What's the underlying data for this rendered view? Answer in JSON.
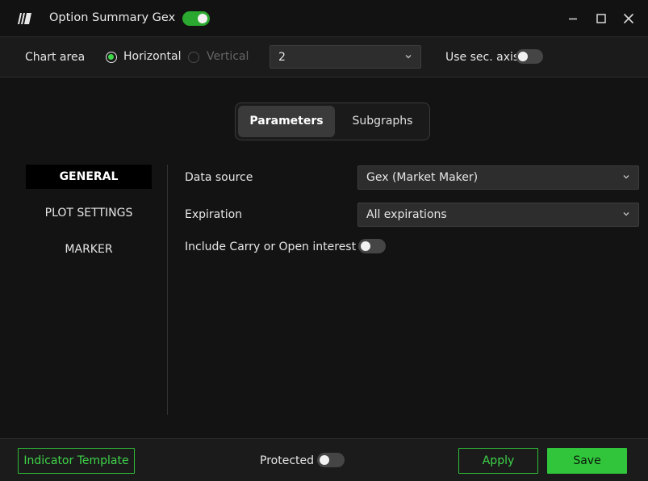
{
  "window": {
    "title": "Option Summary Gex",
    "enabled": true
  },
  "chart_area": {
    "label": "Chart area",
    "options": [
      "Horizontal",
      "Vertical"
    ],
    "selected": "Horizontal",
    "pane_value": "2",
    "sec_axis_label": "Use sec. axis",
    "sec_axis_on": false
  },
  "tabs": {
    "items": [
      "Parameters",
      "Subgraphs"
    ],
    "active": "Parameters"
  },
  "sidebar": {
    "items": [
      {
        "label": "GENERAL",
        "active": true
      },
      {
        "label": "PLOT SETTINGS",
        "active": false
      },
      {
        "label": "MARKER",
        "active": false
      }
    ]
  },
  "general": {
    "data_source_label": "Data source",
    "data_source_value": "Gex (Market Maker)",
    "expiration_label": "Expiration",
    "expiration_value": "All expirations",
    "carry_label": "Include Carry or Open interest",
    "carry_on": false
  },
  "footer": {
    "template_label": "Indicator Template",
    "protected_label": "Protected",
    "protected_on": false,
    "apply_label": "Apply",
    "save_label": "Save"
  },
  "colors": {
    "accent": "#30c53a",
    "background": "#131313",
    "panel": "#1b1b1b"
  }
}
